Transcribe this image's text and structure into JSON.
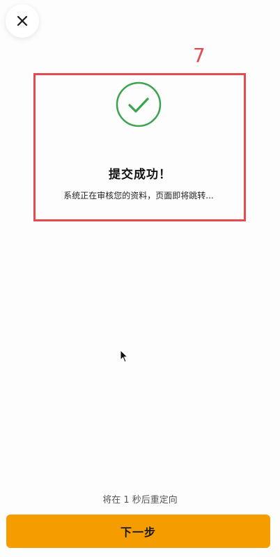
{
  "header": {
    "close_icon": "close-icon"
  },
  "annotation": {
    "step_number": "7",
    "color": "#e34b50"
  },
  "status": {
    "icon": "check-circle-icon",
    "icon_color": "#3aa34e",
    "title": "提交成功！",
    "message": "系统正在审核您的资料，页面即将跳转..."
  },
  "footer": {
    "redirect_text": "将在 1 秒后重定向",
    "next_button_label": "下一步",
    "button_color": "#f59c00"
  }
}
